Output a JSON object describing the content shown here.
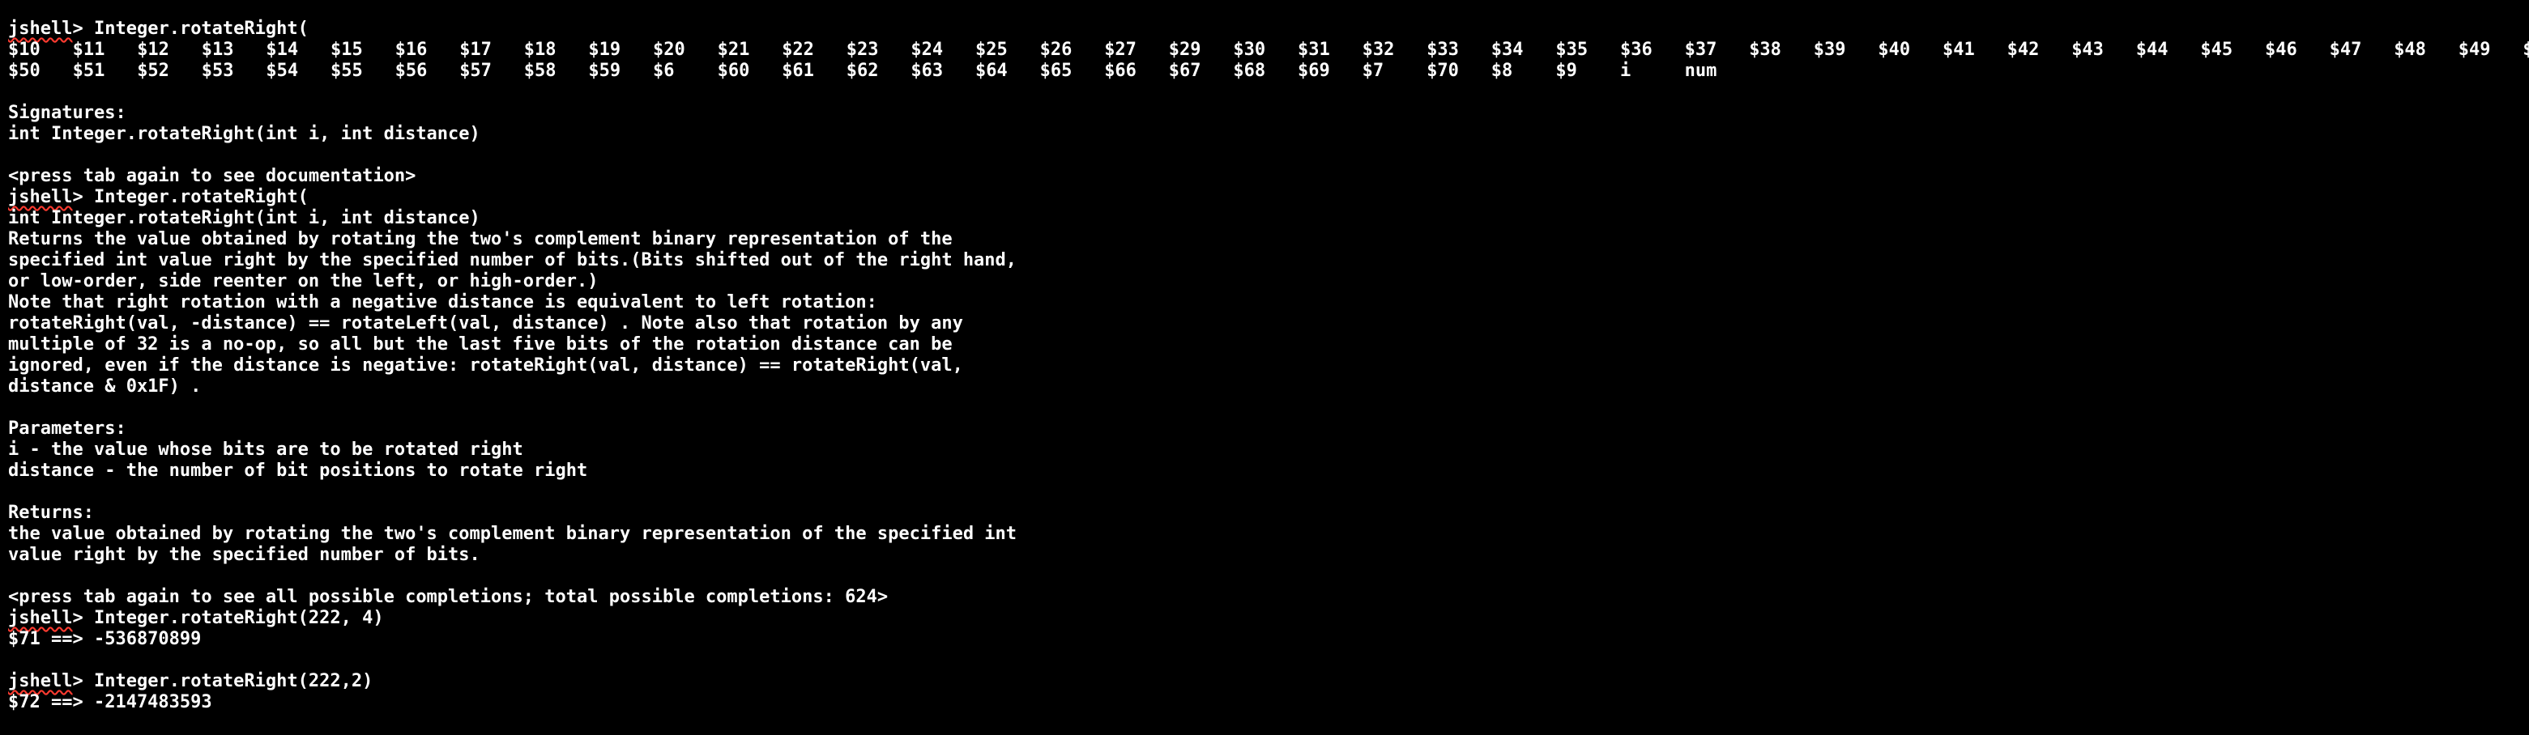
{
  "terminal": {
    "prompt_word": "jshell",
    "prompt_suffix": "> ",
    "first_command": "Integer.rotateRight(",
    "completion_rows": [
      [
        "$10",
        "$11",
        "$12",
        "$13",
        "$14",
        "$15",
        "$16",
        "$17",
        "$18",
        "$19",
        "$20",
        "$21",
        "$22",
        "$23",
        "$24",
        "$25",
        "$26",
        "$27",
        "$29",
        "$30",
        "$31",
        "$32",
        "$33",
        "$34",
        "$35",
        "$36",
        "$37",
        "$38",
        "$39",
        "$40",
        "$41",
        "$42",
        "$43",
        "$44",
        "$45",
        "$46",
        "$47",
        "$48",
        "$49",
        "$"
      ],
      [
        "$50",
        "$51",
        "$52",
        "$53",
        "$54",
        "$55",
        "$56",
        "$57",
        "$58",
        "$59",
        "$6",
        "$60",
        "$61",
        "$62",
        "$63",
        "$64",
        "$65",
        "$66",
        "$67",
        "$68",
        "$69",
        "$7",
        "$70",
        "$8",
        "$9",
        "i",
        "num"
      ]
    ],
    "signatures_header": "Signatures:",
    "signature": "int Integer.rotateRight(int i, int distance)",
    "press_tab_doc": "<press tab again to see documentation>",
    "second_command": "Integer.rotateRight(",
    "doc_lines": [
      "int Integer.rotateRight(int i, int distance)",
      "Returns the value obtained by rotating the two's complement binary representation of the",
      "specified int value right by the specified number of bits.(Bits shifted out of the right hand,",
      "or low-order, side reenter on the left, or high-order.)",
      "Note that right rotation with a negative distance is equivalent to left rotation:",
      "rotateRight(val, -distance) == rotateLeft(val, distance) . Note also that rotation by any",
      "multiple of 32 is a no-op, so all but the last five bits of the rotation distance can be",
      "ignored, even if the distance is negative: rotateRight(val, distance) == rotateRight(val,",
      "distance & 0x1F) ."
    ],
    "parameters_header": "Parameters:",
    "parameters": [
      "i - the value whose bits are to be rotated right",
      "distance - the number of bit positions to rotate right"
    ],
    "returns_header": "Returns:",
    "returns_lines": [
      "the value obtained by rotating the two's complement binary representation of the specified int",
      "value right by the specified number of bits."
    ],
    "press_tab_completions": "<press tab again to see all possible completions; total possible completions: 624>",
    "command_3": "Integer.rotateRight(222, 4)",
    "result_3": "$71 ==> -536870899",
    "command_4": "Integer.rotateRight(222,2)",
    "result_4": "$72 ==> -2147483593"
  }
}
